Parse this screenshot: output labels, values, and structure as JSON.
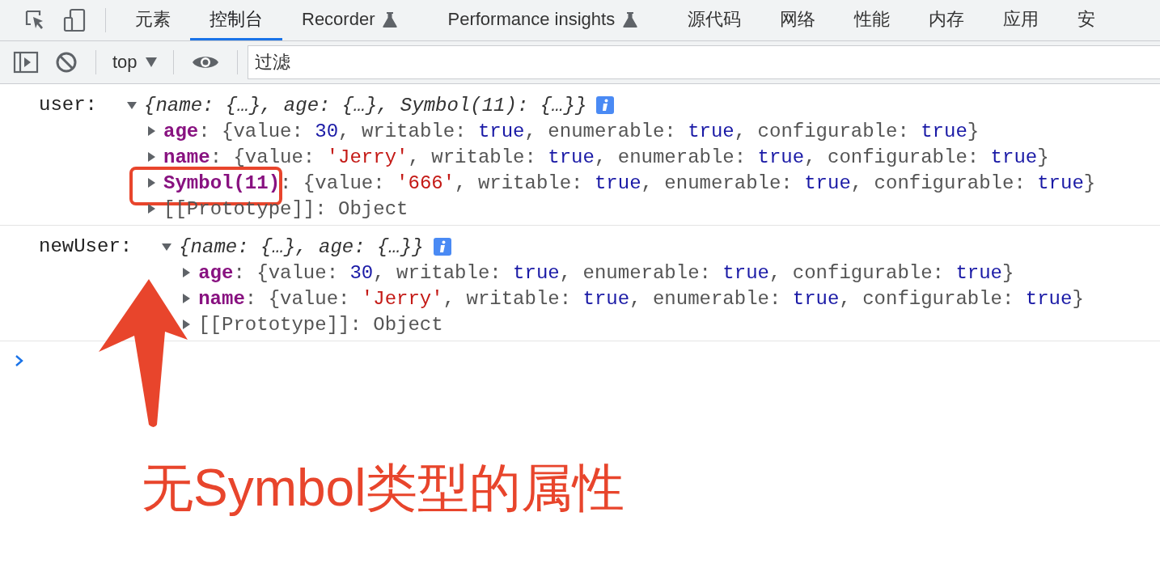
{
  "tabs": [
    {
      "label": "元素",
      "selected": false,
      "experimental": false
    },
    {
      "label": "控制台",
      "selected": true,
      "experimental": false
    },
    {
      "label": "Recorder",
      "selected": false,
      "experimental": true
    },
    {
      "label": "Performance insights",
      "selected": false,
      "experimental": true
    },
    {
      "label": "源代码",
      "selected": false,
      "experimental": false
    },
    {
      "label": "网络",
      "selected": false,
      "experimental": false
    },
    {
      "label": "性能",
      "selected": false,
      "experimental": false
    },
    {
      "label": "内存",
      "selected": false,
      "experimental": false
    },
    {
      "label": "应用",
      "selected": false,
      "experimental": false
    },
    {
      "label": "安",
      "selected": false,
      "experimental": false
    }
  ],
  "toolbar": {
    "context": "top",
    "filter": {
      "placeholder": "过滤"
    }
  },
  "entries": [
    {
      "label": "user:",
      "summary": "{name: {…}, age: {…}, Symbol(11): {…}}",
      "expanded": true,
      "properties": [
        {
          "kind": "field",
          "text": "**age**: {value: 30, writable: true, enumerable: true, configurable: true}",
          "highlighted": false
        },
        {
          "kind": "field",
          "text": "**name**: {value: 'Jerry', writable: true, enumerable: true, configurable: true}",
          "highlighted": false
        },
        {
          "kind": "field",
          "text": "**Symbol(11)**: {value: '666', writable: true, enumerable: true, configurable: true}",
          "highlighted": true
        },
        {
          "kind": "proto",
          "text": "[[Prototype]]: Object",
          "highlighted": false
        }
      ]
    },
    {
      "label": "newUser:",
      "summary": "{name: {…}, age: {…}}",
      "expanded": true,
      "properties": [
        {
          "kind": "field",
          "text": "**age**: {value: 30, writable: true, enumerable: true, configurable: true}",
          "highlighted": false
        },
        {
          "kind": "field",
          "text": "**name**: {value: 'Jerry', writable: true, enumerable: true, configurable: true}",
          "highlighted": false
        },
        {
          "kind": "proto",
          "text": "[[Prototype]]: Object",
          "highlighted": false
        }
      ]
    }
  ],
  "annotation": {
    "caption": "无Symbol类型的属性"
  }
}
